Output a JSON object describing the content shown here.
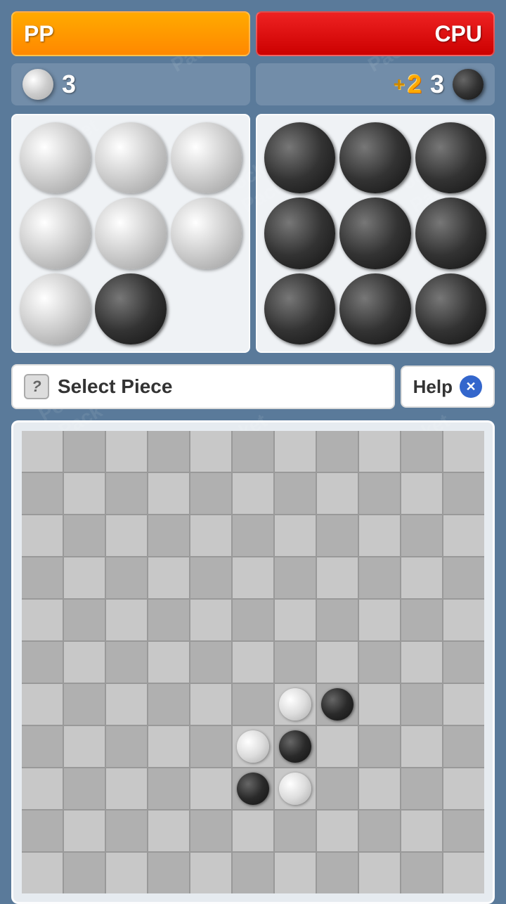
{
  "players": {
    "pp": {
      "label": "PP",
      "score": "3",
      "bar_color": "orange"
    },
    "cpu": {
      "label": "CPU",
      "score": "3",
      "bar_color": "red",
      "bonus": "+2"
    }
  },
  "ui": {
    "select_piece_label": "Select Piece",
    "help_label": "Help",
    "question_mark": "?",
    "close_x": "✕"
  },
  "pp_piece_grid": [
    [
      "w",
      "w",
      "w"
    ],
    [
      "w",
      "w",
      "w"
    ],
    [
      "w",
      "b",
      "e"
    ]
  ],
  "cpu_piece_grid": [
    [
      "b",
      "b",
      "b"
    ],
    [
      "b",
      "b",
      "b"
    ],
    [
      "b",
      "b",
      "b"
    ]
  ],
  "board": {
    "cols": 11,
    "rows": 11,
    "pieces": [
      {
        "row": 6,
        "col": 6,
        "color": "w"
      },
      {
        "row": 6,
        "col": 7,
        "color": "b"
      },
      {
        "row": 7,
        "col": 5,
        "color": "w"
      },
      {
        "row": 7,
        "col": 6,
        "color": "b"
      },
      {
        "row": 8,
        "col": 5,
        "color": "b"
      },
      {
        "row": 8,
        "col": 6,
        "color": "w"
      }
    ]
  },
  "watermark_text": "Pocket\nPack"
}
